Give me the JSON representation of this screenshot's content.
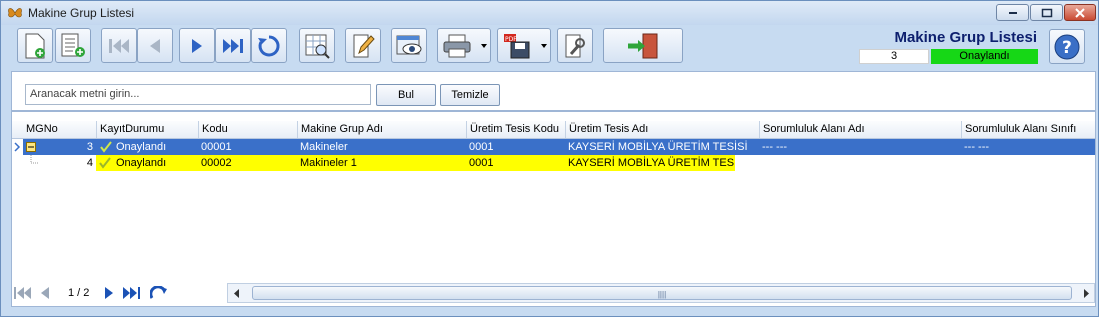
{
  "window": {
    "title": "Makine Grup Listesi"
  },
  "header": {
    "title": "Makine Grup Listesi",
    "count": "3",
    "status": "Onaylandı",
    "status_color": "#16d716"
  },
  "search": {
    "placeholder": "Aranacak metni girin...",
    "find_label": "Bul",
    "clear_label": "Temizle"
  },
  "table": {
    "columns": [
      "MGNo",
      "KayıtDurumu",
      "Kodu",
      "Makine Grup Adı",
      "Üretim Tesis Kodu",
      "Üretim Tesis Adı",
      "Sorumluluk Alanı Adı",
      "Sorumluluk Alanı Sınıfı"
    ],
    "rows": [
      {
        "mgno": "3",
        "durum": "Onaylandı",
        "kodu": "00001",
        "ad": "Makineler",
        "tesis_kodu": "0001",
        "tesis_adi": "KAYSERİ MOBİLYA ÜRETİM TESİSİ",
        "sorumluluk_adi": "--- ---",
        "sorumluluk_sinifi": "--- ---"
      },
      {
        "mgno": "4",
        "durum": "Onaylandı",
        "kodu": "00002",
        "ad": "Makineler 1",
        "tesis_kodu": "0001",
        "tesis_adi": "KAYSERİ MOBİLYA ÜRETİM TESİSİ",
        "sorumluluk_adi": "",
        "sorumluluk_sinifi": ""
      }
    ],
    "selected_row_color": "#3a70c9",
    "highlight_color": "#ffff00"
  },
  "pager": {
    "text": "1 / 2"
  }
}
